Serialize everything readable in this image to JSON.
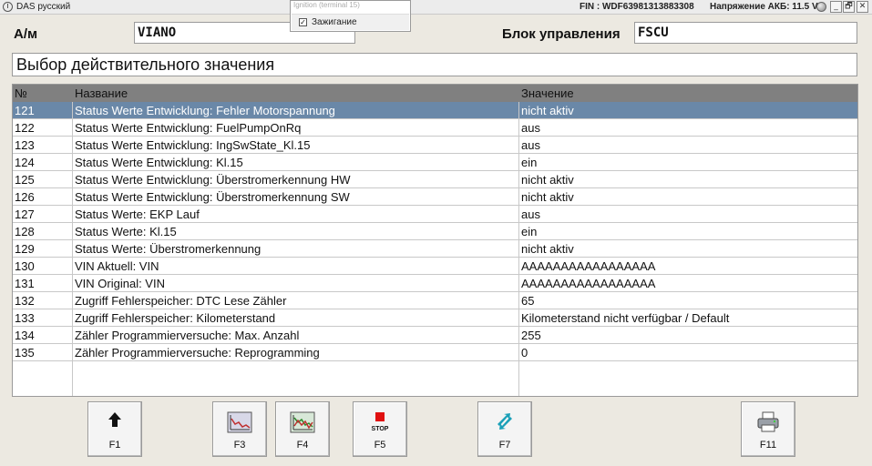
{
  "titlebar": {
    "app_title": "DAS русский",
    "fin": "FIN : WDF63981313883308",
    "voltage": "Напряжение АКБ: 11.5 V",
    "minimize": "_",
    "maximize": "🗗",
    "close": "✕"
  },
  "ignition_popup": {
    "header": "Ignition (terminal 15)",
    "checkbox_mark": "☑",
    "option_label": "Зажигание",
    "checked": true
  },
  "header": {
    "model_label": "А/м",
    "model_value": "VIANO",
    "unit_label": "Блок управления",
    "unit_value": "FSCU"
  },
  "subtitle": "Выбор действительного значения",
  "table": {
    "columns": [
      "№",
      "Название",
      "Значение"
    ],
    "selected_index": 0,
    "rows": [
      {
        "no": "121",
        "name": "Status Werte Entwicklung: Fehler Motorspannung",
        "value": "nicht aktiv"
      },
      {
        "no": "122",
        "name": "Status Werte Entwicklung: FuelPumpOnRq",
        "value": "aus"
      },
      {
        "no": "123",
        "name": "Status Werte Entwicklung: IngSwState_Kl.15",
        "value": "aus"
      },
      {
        "no": "124",
        "name": "Status Werte Entwicklung: Kl.15",
        "value": "ein"
      },
      {
        "no": "125",
        "name": "Status Werte Entwicklung: Überstromerkennung HW",
        "value": "nicht aktiv"
      },
      {
        "no": "126",
        "name": "Status Werte Entwicklung: Überstromerkennung SW",
        "value": "nicht aktiv"
      },
      {
        "no": "127",
        "name": "Status Werte: EKP Lauf",
        "value": "aus"
      },
      {
        "no": "128",
        "name": "Status Werte: Kl.15",
        "value": "ein"
      },
      {
        "no": "129",
        "name": "Status Werte: Überstromerkennung",
        "value": "nicht aktiv"
      },
      {
        "no": "130",
        "name": "VIN Aktuell: VIN",
        "value": "AAAAAAAAAAAAAAAAA"
      },
      {
        "no": "131",
        "name": "VIN Original: VIN",
        "value": "AAAAAAAAAAAAAAAAA"
      },
      {
        "no": "132",
        "name": "Zugriff Fehlerspeicher: DTC Lese Zähler",
        "value": "65"
      },
      {
        "no": "133",
        "name": "Zugriff Fehlerspeicher: Kilometerstand",
        "value": "Kilometerstand nicht verfügbar / Default"
      },
      {
        "no": "134",
        "name": "Zähler Programmierversuche: Max. Anzahl",
        "value": "255"
      },
      {
        "no": "135",
        "name": "Zähler Programmierversuche: Reprogramming",
        "value": "0"
      }
    ]
  },
  "toolbar": [
    {
      "key": "F1",
      "icon": "arrow-up-icon"
    },
    {
      "key": "F3",
      "icon": "graph-icon"
    },
    {
      "key": "F4",
      "icon": "multi-graph-icon"
    },
    {
      "key": "F5",
      "icon": "stop-icon",
      "icon_text": "STOP"
    },
    {
      "key": "F7",
      "icon": "swap-arrows-icon"
    },
    {
      "key": "F11",
      "icon": "printer-icon"
    }
  ],
  "colors": {
    "selected_row": "#6a88a8",
    "header_row": "#808080",
    "stop_red": "#e01010",
    "swap_teal": "#1aa0b8"
  }
}
